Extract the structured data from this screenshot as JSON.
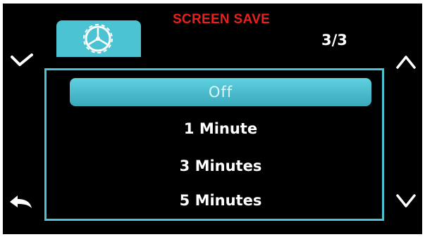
{
  "header": {
    "title": "SCREEN SAVE",
    "page_indicator": "3/3",
    "tab_icon": "gear-icon"
  },
  "menu": {
    "items": [
      {
        "label": "Off",
        "selected": true
      },
      {
        "label": "1 Minute",
        "selected": false
      },
      {
        "label": "3 Minutes",
        "selected": false
      },
      {
        "label": "5 Minutes",
        "selected": false
      }
    ]
  },
  "nav_icons": {
    "left_top": "check-icon",
    "left_bottom": "back-arrow-icon",
    "right_top": "chevron-up-icon",
    "right_bottom": "chevron-down-icon"
  },
  "colors": {
    "accent": "#4cc3d3",
    "title": "#e8201c",
    "background": "#000000",
    "text": "#ffffff"
  }
}
